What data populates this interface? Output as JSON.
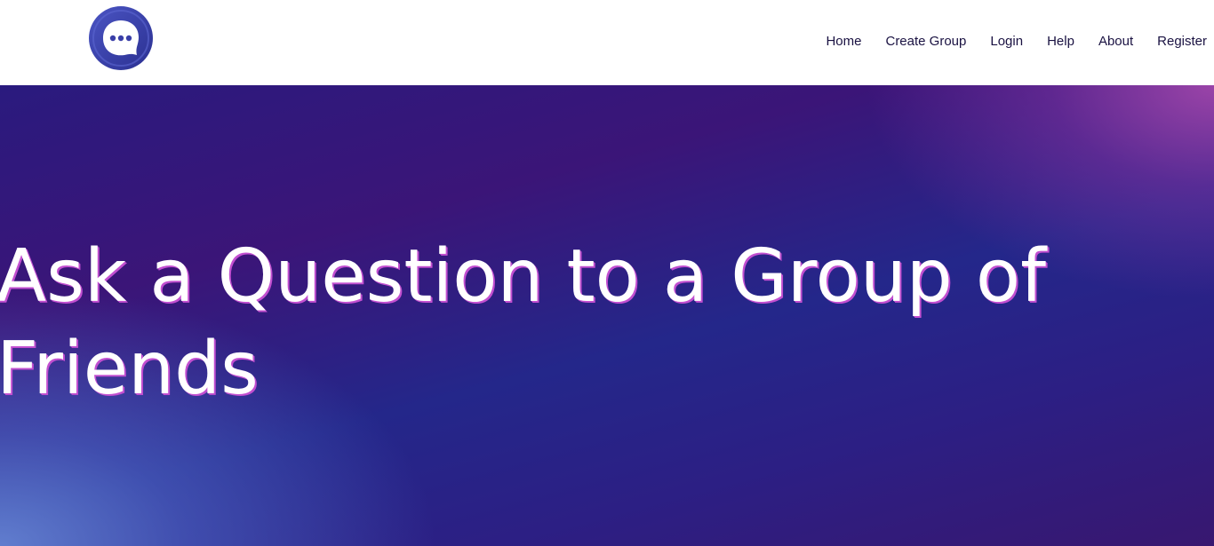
{
  "header": {
    "logo_icon": "chat-bubble-icon",
    "nav": [
      {
        "label": "Home"
      },
      {
        "label": "Create Group"
      },
      {
        "label": "Login"
      },
      {
        "label": "Help"
      },
      {
        "label": "About"
      },
      {
        "label": "Register"
      }
    ]
  },
  "hero": {
    "title": "Ask a Question to a Group of Friends"
  },
  "colors": {
    "nav_text": "#1a1242",
    "hero_deep": "#2a1a7e",
    "hero_magenta": "#a046aa",
    "hero_blue": "#6482d2",
    "title_outline": "#c24fd0",
    "logo_blue": "#3a3fa8"
  }
}
